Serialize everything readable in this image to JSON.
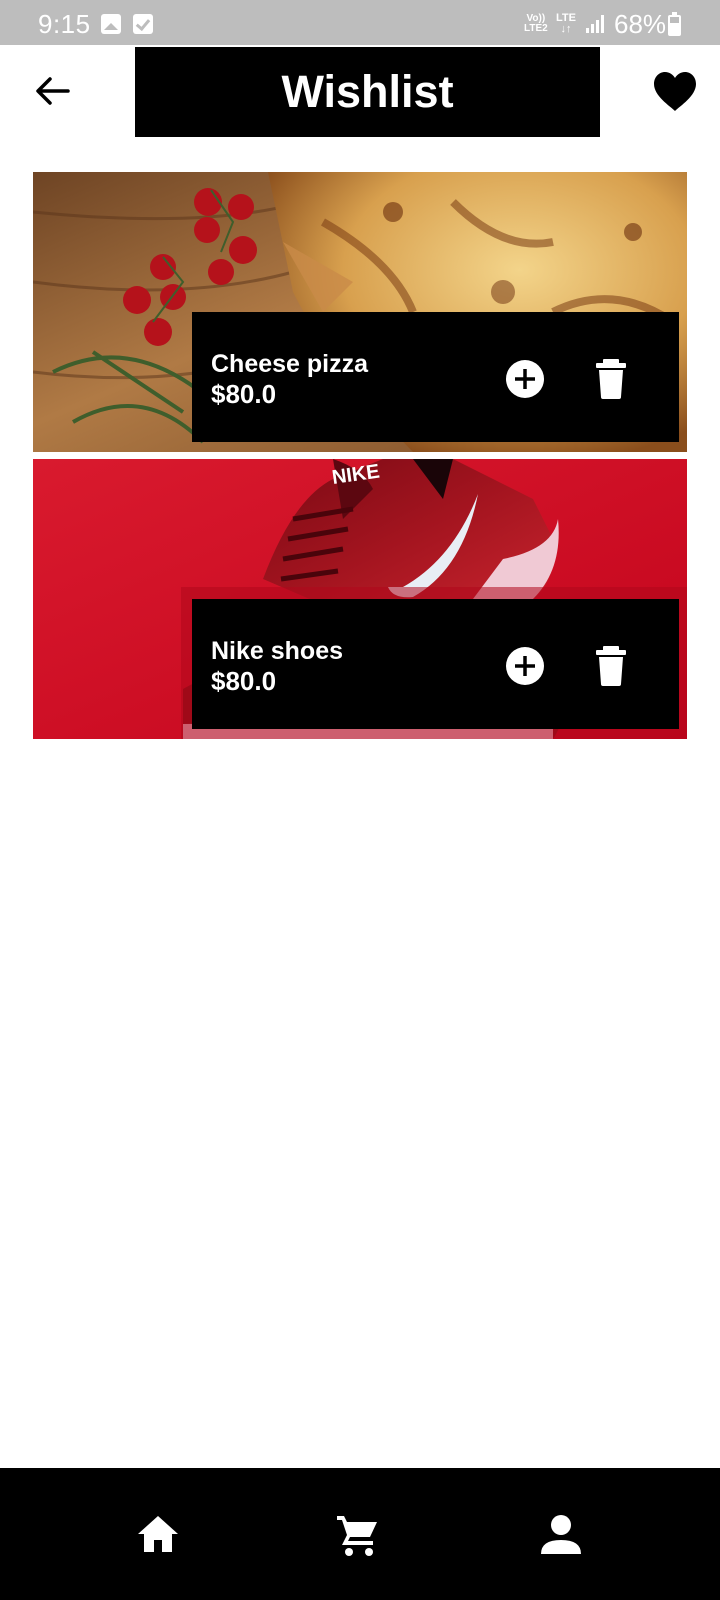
{
  "status_bar": {
    "time": "9:15",
    "network_volte_top": "Vo))",
    "network_volte_bottom": "LTE2",
    "network_lte_top": "LTE",
    "network_lte_bottom": "↓↑",
    "battery_percent": "68%"
  },
  "app_bar": {
    "title": "Wishlist",
    "back_icon": "arrow-left-icon",
    "favorite_icon": "heart-icon"
  },
  "wishlist": {
    "items": [
      {
        "name": "Cheese pizza",
        "price": "$80.0",
        "image": "pizza-photo"
      },
      {
        "name": "Nike shoes",
        "price": "$80.0",
        "image": "nike-shoe-photo"
      }
    ]
  },
  "bottom_nav": {
    "items": [
      {
        "icon": "home-icon"
      },
      {
        "icon": "cart-icon"
      },
      {
        "icon": "person-icon"
      }
    ]
  },
  "colors": {
    "status_bar": "#bdbdbd",
    "panel": "#000000",
    "accent_text": "#ffffff",
    "shoe_background": "#d1061f"
  }
}
